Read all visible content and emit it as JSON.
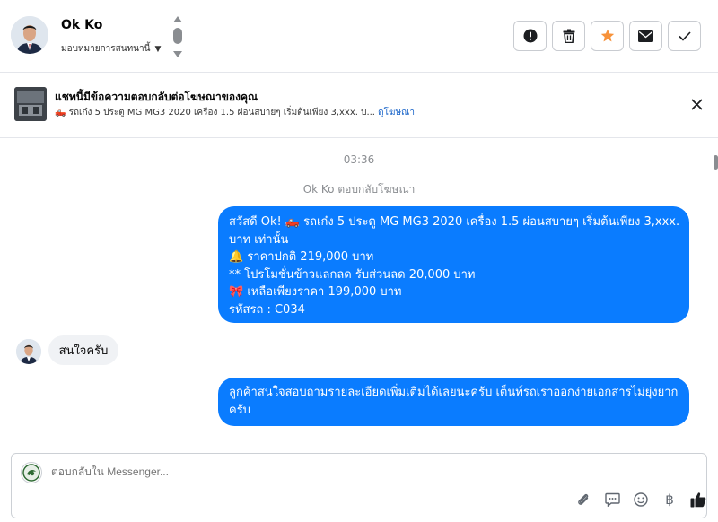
{
  "header": {
    "contact_name": "Ok Ko",
    "assign_label": "มอบหมายการสนทนานี้"
  },
  "actions": {
    "icons": [
      "exclamation-icon",
      "trash-icon",
      "star-icon",
      "envelope-icon",
      "check-icon"
    ],
    "star_color": "#f7923a"
  },
  "ad": {
    "title": "แชทนี้มีข้อความตอบกลับต่อโฆษณาของคุณ",
    "subtitle": "🛻 รถเก๋ง 5 ประตู MG MG3 2020 เครื่อง 1.5 ผ่อนสบายๆ เริ่มต้นเพียง 3,xxx. บ...",
    "link": "ดูโฆษณา"
  },
  "thread": {
    "time": "03:36",
    "note": "Ok Ko ตอบกลับโฆษณา",
    "outgoing_1": [
      "สวัสดี Ok! 🛻 รถเก๋ง 5 ประตู MG MG3 2020 เครื่อง 1.5 ผ่อนสบายๆ เริ่มต้นเพียง 3,xxx.",
      "บาท เท่านั้น",
      "🔔 ราคาปกติ 219,000 บาท",
      "** โปรโมชั่นข้าวแลกลด รับส่วนลด 20,000 บาท",
      "🎀  เหลือเพียงราคา 199,000 บาท",
      " รหัสรถ : C034"
    ],
    "incoming": "สนใจครับ",
    "outgoing_2": "ลูกค้าสนใจสอบถามรายละเอียดเพิ่มเติมได้เลยนะครับ เต็นท์รถเราออกง่ายเอกสารไม่ยุ่งยากครับ",
    "bubble_color": "#0a7cff"
  },
  "composer": {
    "placeholder": "ตอบกลับใน Messenger...",
    "icons": [
      "paperclip-icon",
      "saved-reply-icon",
      "emoji-icon",
      "baht-icon",
      "like-icon"
    ],
    "baht_glyph": "฿"
  }
}
